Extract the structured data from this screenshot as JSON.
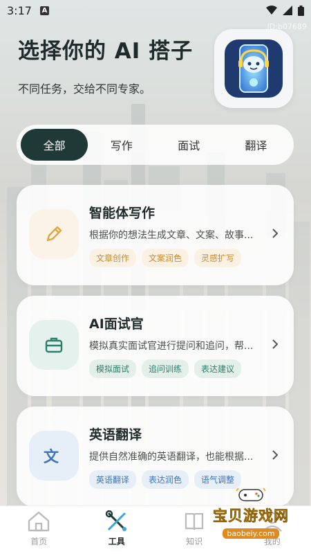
{
  "status": {
    "time": "3:17",
    "a_indicator": "A"
  },
  "watermark_id": "ID:b07689",
  "header": {
    "title": "选择你的 AI 搭子",
    "subtitle": "不同任务，交给不同专家。"
  },
  "tabs": [
    {
      "label": "全部",
      "active": true
    },
    {
      "label": "写作",
      "active": false
    },
    {
      "label": "面试",
      "active": false
    },
    {
      "label": "翻译",
      "active": false
    }
  ],
  "cards": [
    {
      "title": "智能体写作",
      "desc": "根据你的想法生成文章、文案、故事...",
      "icon": "pencil-icon",
      "icon_bg": "#fbf3e8",
      "icon_color": "#e0a63c",
      "tags": [
        "文章创作",
        "文案润色",
        "灵感扩写"
      ],
      "tag_bg": "#fbf1e2",
      "tag_color": "#c98a2b"
    },
    {
      "title": "AI面试官",
      "desc": "模拟真实面试官进行提问和追问，帮...",
      "icon": "briefcase-icon",
      "icon_bg": "#e4f1ec",
      "icon_color": "#2e7d6b",
      "tags": [
        "模拟面试",
        "追问训练",
        "表达建议"
      ],
      "tag_bg": "#e3efe9",
      "tag_color": "#2e7d6b"
    },
    {
      "title": "英语翻译",
      "desc": "提供自然准确的英语翻译，也能根据...",
      "icon": "translate-icon",
      "icon_bg": "#e6eef8",
      "icon_color": "#3f74b8",
      "tags": [
        "英语翻译",
        "表达润色",
        "语气调整"
      ],
      "tag_bg": "#e6eef8",
      "tag_color": "#3f74b8"
    }
  ],
  "bottom_nav": [
    {
      "label": "首页",
      "active": false
    },
    {
      "label": "工具",
      "active": true
    },
    {
      "label": "知识",
      "active": false
    },
    {
      "label": "我的",
      "active": false
    }
  ],
  "site_watermark": {
    "main": "宝贝游戏网",
    "sub": "baobeiy.com"
  }
}
